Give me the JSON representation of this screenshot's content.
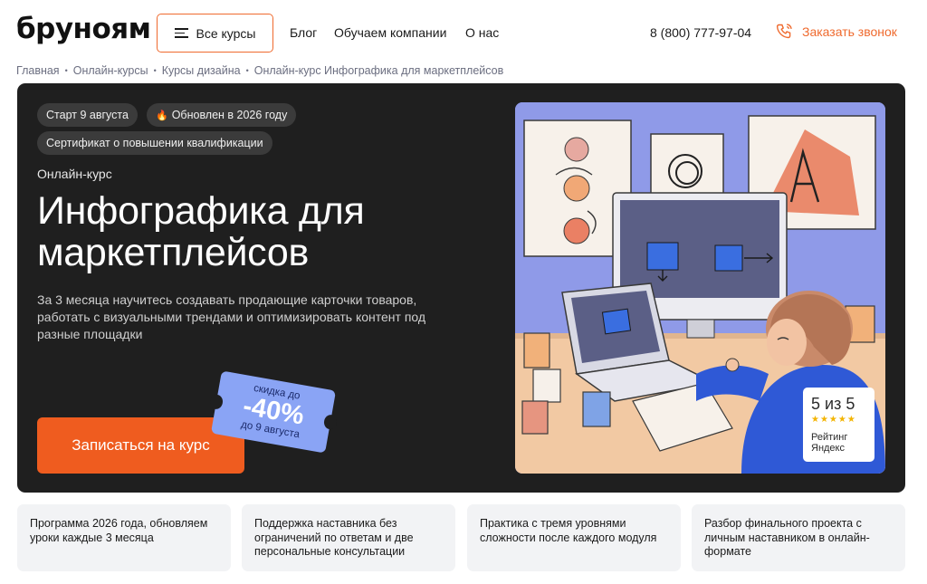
{
  "header": {
    "logo": "бруноям",
    "all_courses": "Все курсы",
    "nav": [
      "Блог",
      "Обучаем компании",
      "О нас"
    ],
    "phone": "8 (800) 777-97-04",
    "callback": "Заказать звонок"
  },
  "breadcrumbs": [
    "Главная",
    "Онлайн-курсы",
    "Курсы дизайна",
    "Онлайн-курс Инфографика для маркетплейсов"
  ],
  "hero": {
    "chips": [
      "Старт 9 августа",
      "Обновлен в 2026 году",
      "Сертификат о повышении квалификации"
    ],
    "fire_icon": "🔥",
    "label": "Онлайн-курс",
    "title": "Инфографика для маркетплейсов",
    "description": "За 3 месяца научитесь создавать продающие карточки товаров, работать с визуальными трендами и оптимизировать контент под разные площадки",
    "cta": "Записаться на курс",
    "discount": {
      "top": "скидка до",
      "value": "-40%",
      "bottom": "до 9 августа"
    },
    "rating": {
      "score": "5 из 5",
      "stars": "★★★★★",
      "label": "Рейтинг Яндекс"
    }
  },
  "features": [
    "Программа 2026 года, обновляем уроки каждые 3 месяца",
    "Поддержка наставника без ограничений по ответам и две персональные консультации",
    "Практика с тремя уровнями сложности после каждого модуля",
    "Разбор финального проекта с личным наставником в онлайн-формате"
  ],
  "colors": {
    "accent": "#ef5c1f",
    "hero_bg": "#1f1f1f",
    "ticket": "#8aa4f5"
  }
}
